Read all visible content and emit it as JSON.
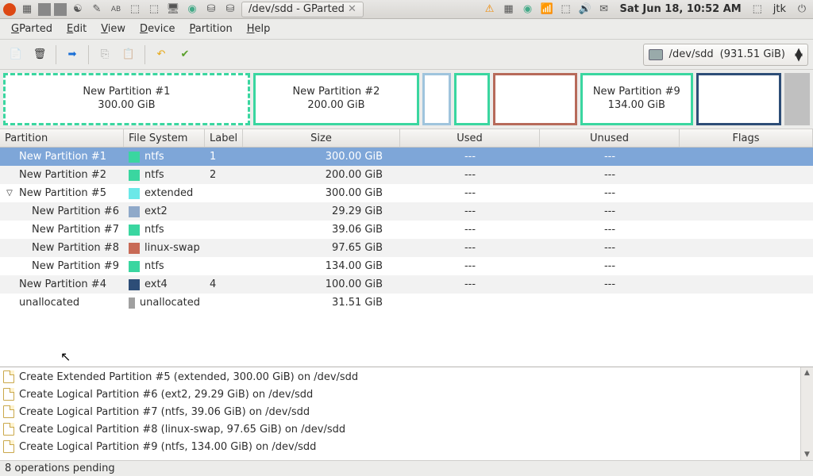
{
  "os_panel": {
    "window_title": "/dev/sdd - GParted",
    "clock": "Sat Jun 18, 10:52 AM",
    "user": "jtk"
  },
  "menubar": [
    "GParted",
    "Edit",
    "View",
    "Device",
    "Partition",
    "Help"
  ],
  "device_selector": {
    "device": "/dev/sdd",
    "size": "(931.51 GiB)"
  },
  "col_headers": [
    "Partition",
    "File System",
    "Label",
    "Size",
    "Used",
    "Unused",
    "Flags"
  ],
  "visual": [
    {
      "label": "New Partition #1",
      "size": "300.00 GiB",
      "color": "#3ad6a0",
      "flex": 300,
      "style": "dashed"
    },
    {
      "label": "New Partition #2",
      "size": "200.00 GiB",
      "color": "#3ad6a0",
      "flex": 200,
      "style": "solid"
    },
    {
      "label": "",
      "size": "",
      "color": "#9fc4dd",
      "flex": 29,
      "style": "solid"
    },
    {
      "label": "",
      "size": "",
      "color": "#3ad6a0",
      "flex": 39,
      "style": "solid"
    },
    {
      "label": "",
      "size": "",
      "color": "#b76a5a",
      "flex": 98,
      "style": "solid"
    },
    {
      "label": "New Partition #9",
      "size": "134.00 GiB",
      "color": "#3ad6a0",
      "flex": 134,
      "style": "solid"
    },
    {
      "label": "",
      "size": "",
      "color": "#2d4d77",
      "flex": 100,
      "style": "solid"
    },
    {
      "label": "",
      "size": "",
      "color": "#b0b0b0",
      "flex": 31,
      "style": "unalloc"
    }
  ],
  "fs_colors": {
    "ntfs": "#3ad6a0",
    "extended": "#6be8e8",
    "ext2": "#8fa9c9",
    "linux-swap": "#c86a56",
    "ext4": "#2d4d77",
    "unallocated": "#a0a0a0"
  },
  "rows": [
    {
      "indent": 0,
      "expander": "",
      "name": "New Partition #1",
      "fs": "ntfs",
      "label": "1",
      "size": "300.00 GiB",
      "used": "---",
      "unused": "---",
      "flags": "",
      "sel": true
    },
    {
      "indent": 0,
      "expander": "",
      "name": "New Partition #2",
      "fs": "ntfs",
      "label": "2",
      "size": "200.00 GiB",
      "used": "---",
      "unused": "---",
      "flags": ""
    },
    {
      "indent": 0,
      "expander": "▽",
      "name": "New Partition #5",
      "fs": "extended",
      "label": "",
      "size": "300.00 GiB",
      "used": "---",
      "unused": "---",
      "flags": ""
    },
    {
      "indent": 1,
      "expander": "",
      "name": "New Partition #6",
      "fs": "ext2",
      "label": "",
      "size": "29.29 GiB",
      "used": "---",
      "unused": "---",
      "flags": ""
    },
    {
      "indent": 1,
      "expander": "",
      "name": "New Partition #7",
      "fs": "ntfs",
      "label": "",
      "size": "39.06 GiB",
      "used": "---",
      "unused": "---",
      "flags": ""
    },
    {
      "indent": 1,
      "expander": "",
      "name": "New Partition #8",
      "fs": "linux-swap",
      "label": "",
      "size": "97.65 GiB",
      "used": "---",
      "unused": "---",
      "flags": ""
    },
    {
      "indent": 1,
      "expander": "",
      "name": "New Partition #9",
      "fs": "ntfs",
      "label": "",
      "size": "134.00 GiB",
      "used": "---",
      "unused": "---",
      "flags": ""
    },
    {
      "indent": 0,
      "expander": "",
      "name": "New Partition #4",
      "fs": "ext4",
      "label": "4",
      "size": "100.00 GiB",
      "used": "---",
      "unused": "---",
      "flags": ""
    },
    {
      "indent": 0,
      "expander": "",
      "name": "unallocated",
      "fs": "unallocated",
      "label": "",
      "size": "31.51 GiB",
      "used": "",
      "unused": "",
      "flags": ""
    }
  ],
  "operations": [
    "Create Extended Partition #5 (extended, 300.00 GiB) on /dev/sdd",
    "Create Logical Partition #6 (ext2, 29.29 GiB) on /dev/sdd",
    "Create Logical Partition #7 (ntfs, 39.06 GiB) on /dev/sdd",
    "Create Logical Partition #8 (linux-swap, 97.65 GiB) on /dev/sdd",
    "Create Logical Partition #9 (ntfs, 134.00 GiB) on /dev/sdd"
  ],
  "status": "8 operations pending"
}
